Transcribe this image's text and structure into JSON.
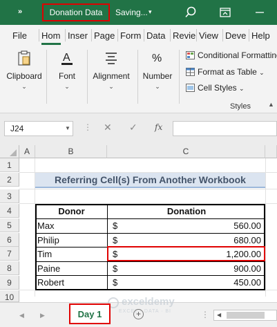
{
  "titlebar": {
    "chevron": "»",
    "workbook_title": "Donation Data",
    "saving_status": "Saving...",
    "caret": "▾",
    "icons": [
      "search-icon",
      "ribbon-display-icon",
      "minimize-icon"
    ],
    "bg_color": "#217346"
  },
  "ribbon_tabs": [
    "File",
    "Hom",
    "Inser",
    "Page",
    "Form",
    "Data",
    "Revie",
    "View",
    "Deve",
    "Help"
  ],
  "ribbon_active_tab": "Hom",
  "ribbon": {
    "clipboard": {
      "label": "Clipboard",
      "icon": "clipboard-icon"
    },
    "font": {
      "label": "Font",
      "icon": "font-color-icon",
      "glyph": "A"
    },
    "alignment": {
      "label": "Alignment",
      "icon": "align-icon"
    },
    "number": {
      "label": "Number",
      "icon": "percent-icon",
      "glyph": "%"
    },
    "styles": {
      "conditional_formatting": "Conditional Formatting",
      "format_as_table": "Format as Table",
      "cell_styles": "Cell Styles",
      "group_label": "Styles"
    },
    "caret": "⌄"
  },
  "formula_bar": {
    "name_box": "J24",
    "fx": "fx",
    "cancel": "✕",
    "enter": "✓",
    "dots": "⋮",
    "value": ""
  },
  "columns": [
    "A",
    "B",
    "C"
  ],
  "rows": [
    "1",
    "2",
    "3",
    "4",
    "5",
    "6",
    "7",
    "8",
    "9",
    "10"
  ],
  "sheet": {
    "title": "Referring Cell(s) From Another Workbook",
    "headers": {
      "donor": "Donor",
      "donation": "Donation"
    },
    "currency_symbol": "$",
    "records": [
      {
        "donor": "Max",
        "donation": "560.00"
      },
      {
        "donor": "Philip",
        "donation": "680.00"
      },
      {
        "donor": "Tim",
        "donation": "1,200.00"
      },
      {
        "donor": "Paine",
        "donation": "900.00"
      },
      {
        "donor": "Robert",
        "donation": "450.00"
      }
    ],
    "highlighted_row": "Tim"
  },
  "sheet_tabs": {
    "active_tab": "Day 1",
    "add_sheet": "+",
    "prev_arrow": "◀",
    "next_arrow": "▶",
    "watermark": "exceldemy",
    "watermark_sub": "EXCEL · DATA · BI"
  },
  "colors": {
    "excel_green": "#217346",
    "highlight_red": "#e00000",
    "title_fill": "#dbe4f0",
    "title_text": "#44546a"
  }
}
